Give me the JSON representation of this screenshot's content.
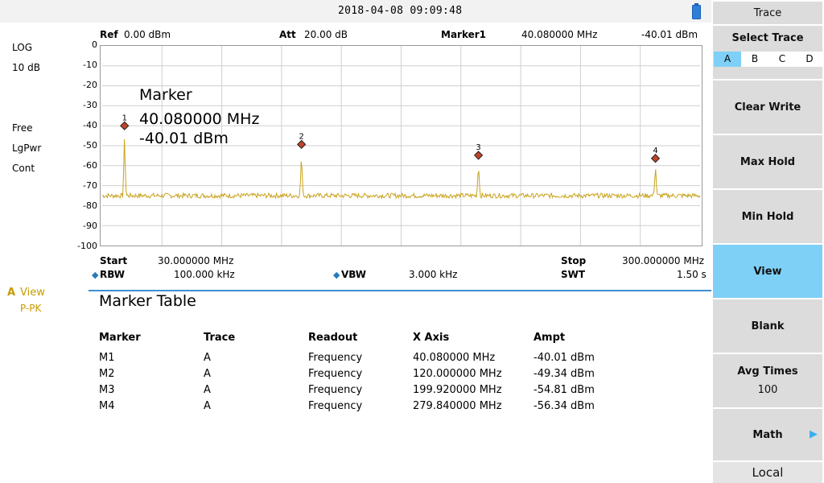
{
  "header": {
    "datetime": "2018-04-08   09:09:48"
  },
  "left_panel": {
    "scale_type": "LOG",
    "scale_div": "10 dB",
    "mode": "Free",
    "detector": "LgPwr",
    "sweep": "Cont",
    "trace_letter": "A",
    "trace_mode": "View",
    "trace_detector": "P-PK"
  },
  "top_info": {
    "ref_label": "Ref",
    "ref_value": "0.00 dBm",
    "att_label": "Att",
    "att_value": "20.00 dB",
    "marker_label": "Marker1",
    "marker_freq": "40.080000 MHz",
    "marker_ampl": "-40.01 dBm"
  },
  "y_ticks": [
    "0",
    "-10",
    "-20",
    "-30",
    "-40",
    "-50",
    "-60",
    "-70",
    "-80",
    "-90",
    "-100"
  ],
  "marker_readout": {
    "title": "Marker",
    "freq": "40.080000 MHz",
    "ampl": "-40.01 dBm"
  },
  "bottom_info": {
    "start_label": "Start",
    "start_value": "30.000000 MHz",
    "stop_label": "Stop",
    "stop_value": "300.000000 MHz",
    "rbw_label": "RBW",
    "rbw_value": "100.000 kHz",
    "vbw_label": "VBW",
    "vbw_value": "3.000 kHz",
    "swt_label": "SWT",
    "swt_value": "1.50 s"
  },
  "marker_table": {
    "title": "Marker Table",
    "headers": [
      "Marker",
      "Trace",
      "Readout",
      "X Axis",
      "Ampt"
    ],
    "rows": [
      [
        "M1",
        "A",
        "Frequency",
        "40.080000 MHz",
        "-40.01 dBm"
      ],
      [
        "M2",
        "A",
        "Frequency",
        "120.000000 MHz",
        "-49.34 dBm"
      ],
      [
        "M3",
        "A",
        "Frequency",
        "199.920000 MHz",
        "-54.81 dBm"
      ],
      [
        "M4",
        "A",
        "Frequency",
        "279.840000 MHz",
        "-56.34 dBm"
      ]
    ]
  },
  "softkeys": {
    "title": "Trace",
    "select_trace": "Select Trace",
    "trace_options": [
      "A",
      "B",
      "C",
      "D"
    ],
    "selected_trace": "A",
    "clear_write": "Clear Write",
    "max_hold": "Max Hold",
    "min_hold": "Min Hold",
    "view": "View",
    "blank": "Blank",
    "avg_times_label": "Avg Times",
    "avg_times_value": "100",
    "math": "Math",
    "local": "Local"
  },
  "chart_data": {
    "type": "line",
    "xlabel": "",
    "ylabel": "",
    "xlim": [
      30,
      300
    ],
    "ylim": [
      -100,
      0
    ],
    "x_unit": "MHz",
    "y_unit": "dBm",
    "noise_floor": -75,
    "markers": [
      {
        "label": "1",
        "x": 40.08,
        "y": -40.01
      },
      {
        "label": "2",
        "x": 120.0,
        "y": -49.34
      },
      {
        "label": "3",
        "x": 199.92,
        "y": -54.81
      },
      {
        "label": "4",
        "x": 279.84,
        "y": -56.34
      }
    ],
    "trace_color": "#c8a21a",
    "marker_color": "#c0442a"
  }
}
